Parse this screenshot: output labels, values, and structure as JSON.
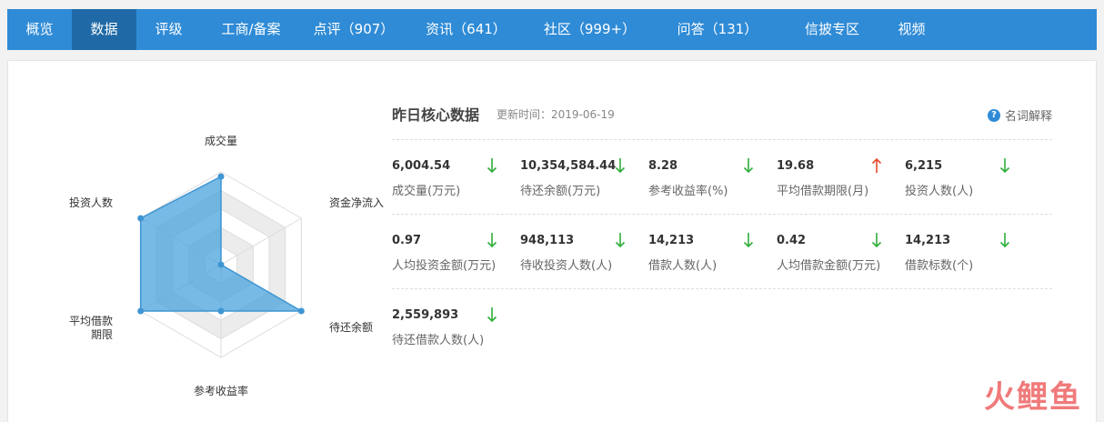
{
  "nav": {
    "tabs": [
      {
        "label": "概览",
        "active": false
      },
      {
        "label": "数据",
        "active": true
      },
      {
        "label": "评级",
        "active": false
      },
      {
        "label": "工商/备案",
        "active": false
      },
      {
        "label": "点评（907）",
        "active": false
      },
      {
        "label": "资讯（641）",
        "active": false
      },
      {
        "label": "社区（999+）",
        "active": false
      },
      {
        "label": "问答（131）",
        "active": false
      },
      {
        "label": "信披专区",
        "active": false
      },
      {
        "label": "视频",
        "active": false
      }
    ]
  },
  "radar": {
    "axes": [
      "成交量",
      "资金净流入",
      "待还余额",
      "参考收益率",
      "平均借款",
      "投资人数"
    ],
    "axis_label_second_line": {
      "平均借款": "期限"
    },
    "values": [
      0.95,
      0.0,
      1.0,
      0.5,
      1.0,
      1.0
    ],
    "fill_color": "#4aa3dd",
    "stroke_color": "#3f95d2"
  },
  "core": {
    "title": "昨日核心数据",
    "update_label": "更新时间：2019-06-19",
    "glossary_label": "名词解释",
    "glossary_icon": "?"
  },
  "metrics": [
    {
      "value": "6,004.54",
      "label": "成交量(万元)",
      "trend": "down"
    },
    {
      "value": "10,354,584.44",
      "label": "待还余额(万元)",
      "trend": "down"
    },
    {
      "value": "8.28",
      "label": "参考收益率(%)",
      "trend": "down"
    },
    {
      "value": "19.68",
      "label": "平均借款期限(月)",
      "trend": "up"
    },
    {
      "value": "6,215",
      "label": "投资人数(人)",
      "trend": "down"
    },
    {
      "value": "0.97",
      "label": "人均投资金额(万元)",
      "trend": "down"
    },
    {
      "value": "948,113",
      "label": "待收投资人数(人)",
      "trend": "down"
    },
    {
      "value": "14,213",
      "label": "借款人数(人)",
      "trend": "down"
    },
    {
      "value": "0.42",
      "label": "人均借款金额(万元)",
      "trend": "down"
    },
    {
      "value": "14,213",
      "label": "借款标数(个)",
      "trend": "down"
    },
    {
      "value": "2,559,893",
      "label": "待还借款人数(人)",
      "trend": "down"
    }
  ],
  "colors": {
    "up": "#e8492f",
    "down": "#2fae3c",
    "nav": "#2f8bd6",
    "nav_active": "#1f6aa6"
  },
  "watermark": "火鲤鱼"
}
